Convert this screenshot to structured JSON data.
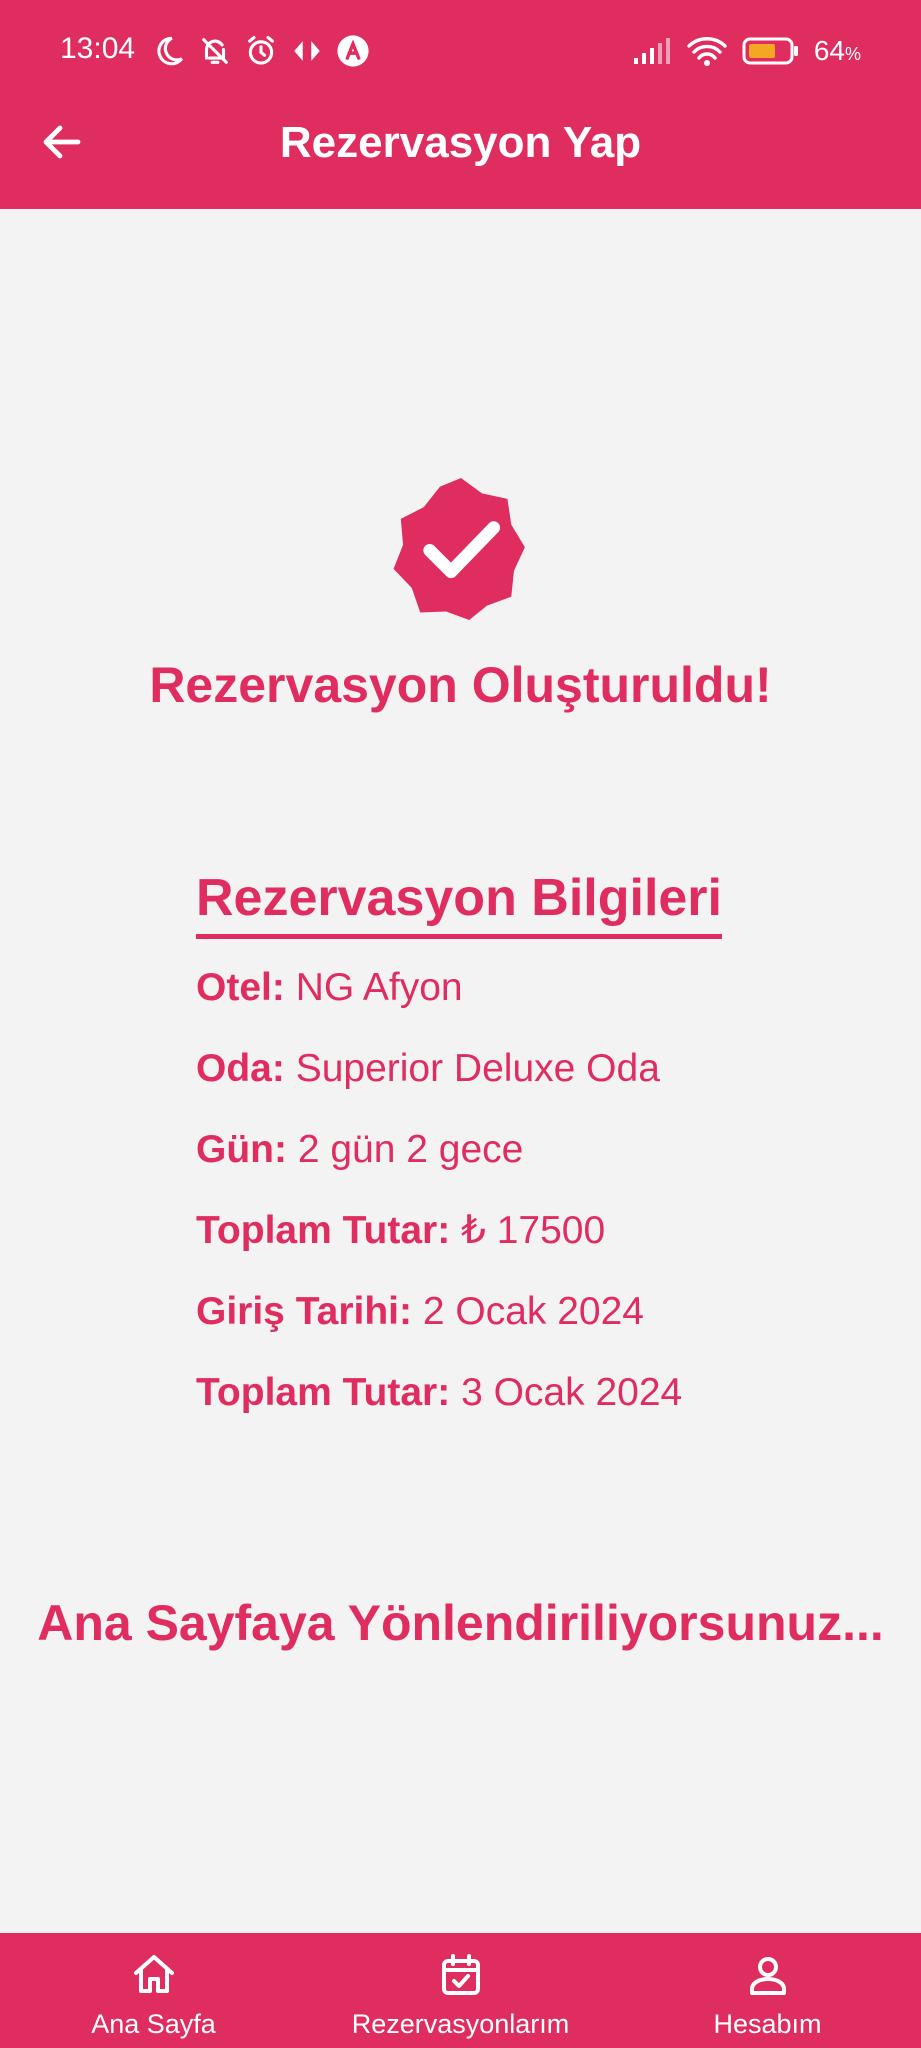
{
  "status_bar": {
    "time": "13:04",
    "battery": "64",
    "battery_unit": "%"
  },
  "header": {
    "title": "Rezervasyon Yap"
  },
  "confirmation": {
    "message": "Rezervasyon Oluşturuldu!"
  },
  "details": {
    "heading": "Rezervasyon Bilgileri",
    "rows": [
      {
        "label": "Otel:",
        "value": "NG Afyon"
      },
      {
        "label": "Oda:",
        "value": "Superior Deluxe Oda"
      },
      {
        "label": "Gün:",
        "value": "2 gün 2 gece"
      },
      {
        "label": "Toplam Tutar:",
        "value": "₺ 17500"
      },
      {
        "label": "Giriş Tarihi:",
        "value": "2 Ocak 2024"
      },
      {
        "label": "Toplam Tutar:",
        "value": "3 Ocak 2024"
      }
    ]
  },
  "redirect": {
    "text": "Ana Sayfaya Yönlendiriliyorsunuz..."
  },
  "bottom_nav": {
    "items": [
      {
        "label": "Ana Sayfa",
        "icon": "home-icon"
      },
      {
        "label": "Rezervasyonlarım",
        "icon": "calendar-check-icon"
      },
      {
        "label": "Hesabım",
        "icon": "person-icon"
      }
    ]
  },
  "colors": {
    "primary": "#df2d60",
    "background": "#f4f3f4",
    "on_primary": "#ffffff",
    "battery_fill": "#f5a623"
  }
}
